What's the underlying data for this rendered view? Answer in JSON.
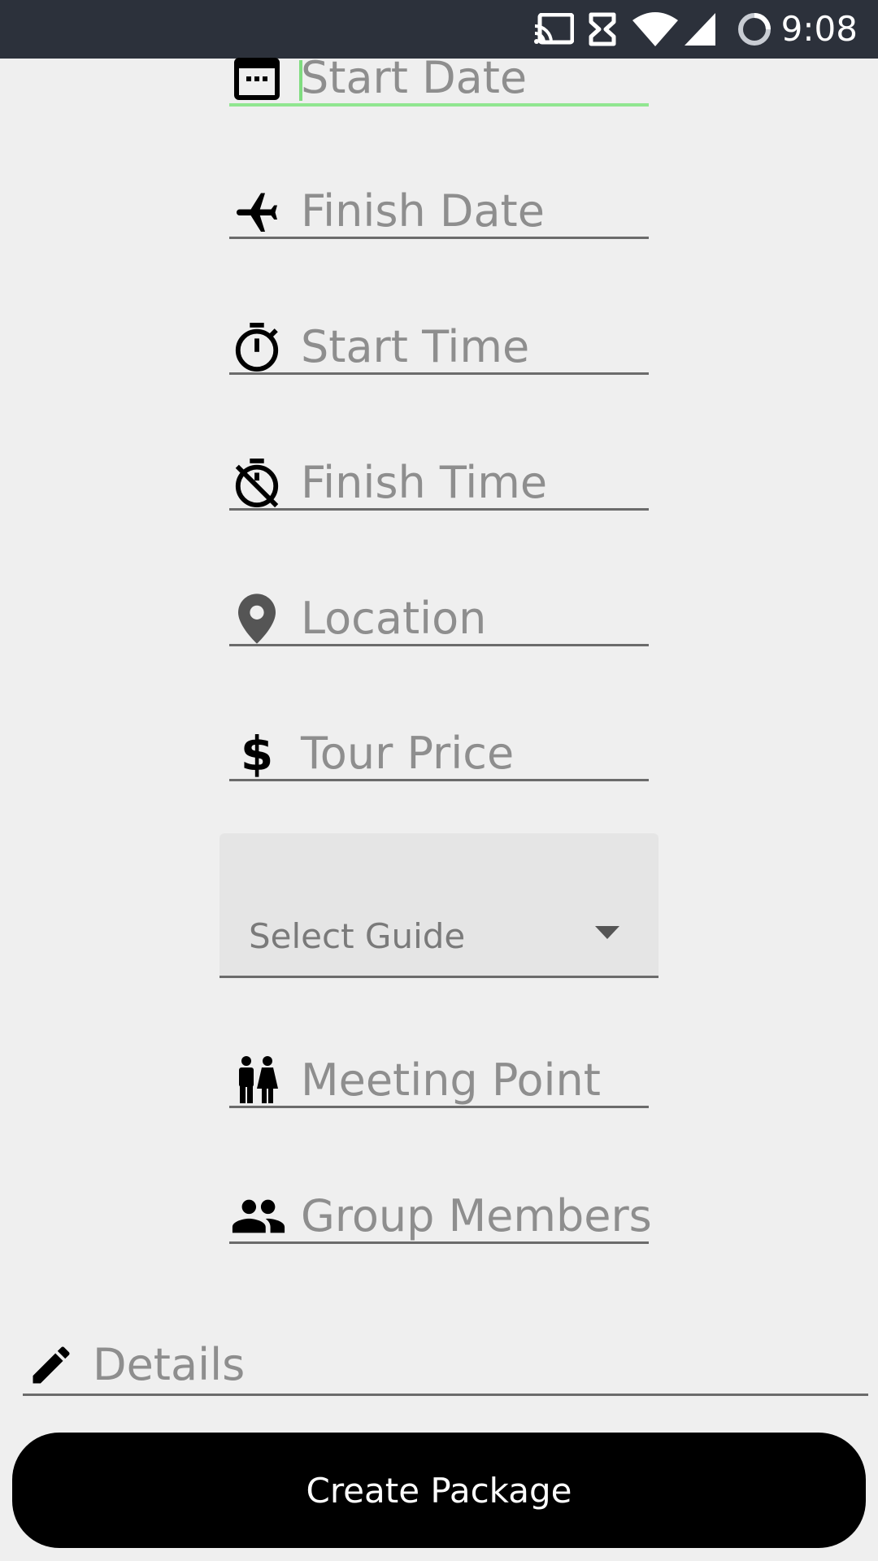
{
  "status_bar": {
    "time": "9:08",
    "icons": [
      "cast-icon",
      "hourglass-icon",
      "wifi-icon",
      "signal-icon",
      "loading-icon"
    ]
  },
  "form": {
    "start_date": {
      "placeholder": "Start Date",
      "icon": "calendar-icon"
    },
    "finish_date": {
      "placeholder": "Finish Date",
      "icon": "airplane-icon"
    },
    "start_time": {
      "placeholder": "Start Time",
      "icon": "timer-icon"
    },
    "finish_time": {
      "placeholder": "Finish Time",
      "icon": "timer-off-icon"
    },
    "location": {
      "placeholder": "Location",
      "icon": "location-pin-icon"
    },
    "tour_price": {
      "placeholder": "Tour Price",
      "icon": "dollar-icon"
    },
    "guide_select": {
      "label": "Select Guide"
    },
    "meeting_point": {
      "placeholder": "Meeting Point",
      "icon": "people-pair-icon"
    },
    "group_members": {
      "placeholder": "Group Members",
      "icon": "group-icon"
    },
    "details": {
      "placeholder": "Details",
      "icon": "pencil-icon"
    }
  },
  "actions": {
    "create_label": "Create Package"
  },
  "colors": {
    "status_bar": "#2c313b",
    "background": "#efefef",
    "focus_underline": "#90e690",
    "button": "#000000"
  }
}
